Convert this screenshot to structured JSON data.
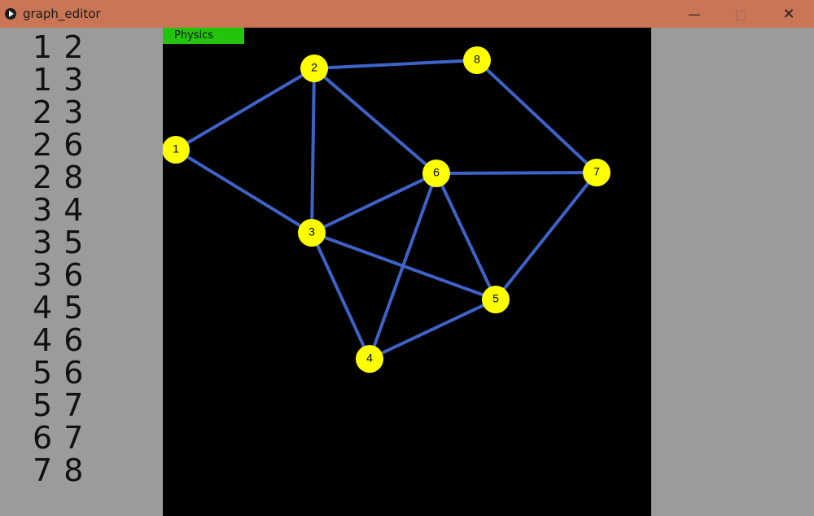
{
  "window": {
    "title": "graph_editor"
  },
  "physics_button": {
    "label": "Physics"
  },
  "edges": [
    {
      "a": "1",
      "b": "2"
    },
    {
      "a": "1",
      "b": "3"
    },
    {
      "a": "2",
      "b": "3"
    },
    {
      "a": "2",
      "b": "6"
    },
    {
      "a": "2",
      "b": "8"
    },
    {
      "a": "3",
      "b": "4"
    },
    {
      "a": "3",
      "b": "5"
    },
    {
      "a": "3",
      "b": "6"
    },
    {
      "a": "4",
      "b": "5"
    },
    {
      "a": "4",
      "b": "6"
    },
    {
      "a": "5",
      "b": "6"
    },
    {
      "a": "5",
      "b": "7"
    },
    {
      "a": "6",
      "b": "7"
    },
    {
      "a": "7",
      "b": "8"
    }
  ],
  "nodes": [
    {
      "id": "1"
    },
    {
      "id": "2"
    },
    {
      "id": "3"
    },
    {
      "id": "4"
    },
    {
      "id": "5"
    },
    {
      "id": "6"
    },
    {
      "id": "7"
    },
    {
      "id": "8"
    }
  ],
  "colors": {
    "canvas": "#000000",
    "node": "#ffff00",
    "edge": "#3e62c8",
    "physics_button": "#22c40c",
    "titlebar": "#c97556",
    "panel": "#9b9b9b"
  }
}
